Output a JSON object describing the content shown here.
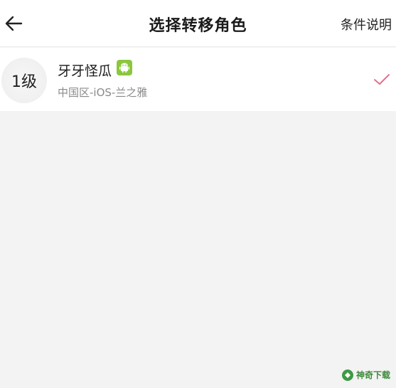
{
  "header": {
    "title": "选择转移角色",
    "conditions_label": "条件说明",
    "back_icon": "arrow-left-icon"
  },
  "roles": [
    {
      "level": "1级",
      "name": "牙牙怪瓜",
      "platform_icon": "android-icon",
      "platform_color": "#8cc63f",
      "server": "中国区-iOS-兰之雅",
      "selected": true,
      "check_color": "#e0728f"
    }
  ],
  "watermark": {
    "text": "神奇下载"
  }
}
